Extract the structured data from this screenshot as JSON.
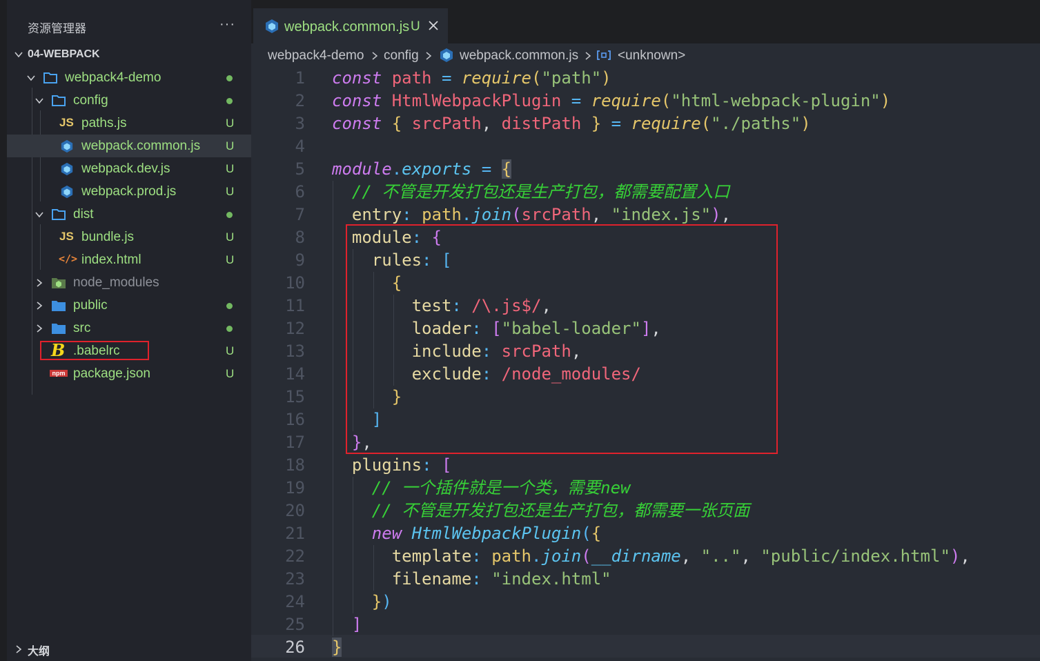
{
  "explorer": {
    "title": "资源管理器",
    "more": "···",
    "section": "04-WEBPACK",
    "outline": "大纲",
    "items": [
      {
        "label": "webpack4-demo",
        "status": "",
        "dot": true
      },
      {
        "label": "config",
        "status": "",
        "dot": true
      },
      {
        "label": "paths.js",
        "status": "U"
      },
      {
        "label": "webpack.common.js",
        "status": "U"
      },
      {
        "label": "webpack.dev.js",
        "status": "U"
      },
      {
        "label": "webpack.prod.js",
        "status": "U"
      },
      {
        "label": "dist",
        "status": "",
        "dot": true
      },
      {
        "label": "bundle.js",
        "status": "U"
      },
      {
        "label": "index.html",
        "status": "U"
      },
      {
        "label": "node_modules",
        "status": ""
      },
      {
        "label": "public",
        "status": "",
        "dot": true
      },
      {
        "label": "src",
        "status": "",
        "dot": true
      },
      {
        "label": ".babelrc",
        "status": "U"
      },
      {
        "label": "package.json",
        "status": "U"
      }
    ]
  },
  "tab": {
    "label": "webpack.common.js",
    "status": "U"
  },
  "breadcrumbs": [
    "webpack4-demo",
    "config",
    "webpack.common.js",
    "<unknown>"
  ],
  "code": {
    "line_numbers": [
      "1",
      "2",
      "3",
      "4",
      "5",
      "6",
      "7",
      "8",
      "9",
      "10",
      "11",
      "12",
      "13",
      "14",
      "15",
      "16",
      "17",
      "18",
      "19",
      "20",
      "21",
      "22",
      "23",
      "24",
      "25",
      "26"
    ],
    "active_line": "26",
    "l1": {
      "kw": "const",
      "var": "path",
      "op": "=",
      "fn": "require",
      "p1": "(",
      "str": "\"path\"",
      "p2": ")"
    },
    "l2": {
      "kw": "const",
      "var": "HtmlWebpackPlugin",
      "op": "=",
      "fn": "require",
      "p1": "(",
      "str": "\"html-webpack-plugin\"",
      "p2": ")"
    },
    "l3": {
      "kw": "const",
      "b1": "{",
      "v1": "srcPath",
      "c": ",",
      "v2": "distPath",
      "b2": "}",
      "op": "=",
      "fn": "require",
      "p1": "(",
      "str": "\"./paths\"",
      "p2": ")"
    },
    "l5": {
      "kw": "module",
      "dot": ".",
      "prop": "exports",
      "op": "=",
      "b": "{"
    },
    "l6": "// 不管是开发打包还是生产打包，都需要配置入口",
    "l7": {
      "key": "entry",
      "colon": ":",
      "obj": "path",
      "dot": ".",
      "fn": "join",
      "p1": "(",
      "arg": "srcPath",
      "c": ",",
      "str": "\"index.js\"",
      "p2": ")",
      "tail": ","
    },
    "l8": {
      "key": "module",
      "colon": ":",
      "b": "{"
    },
    "l9": {
      "key": "rules",
      "colon": ":",
      "b": "["
    },
    "l10": "{",
    "l11": {
      "key": "test",
      "colon": ":",
      "re": "/\\.js$/",
      "tail": ","
    },
    "l12": {
      "key": "loader",
      "colon": ":",
      "b1": "[",
      "str": "\"babel-loader\"",
      "b2": "]",
      "tail": ","
    },
    "l13": {
      "key": "include",
      "colon": ":",
      "val": "srcPath",
      "tail": ","
    },
    "l14": {
      "key": "exclude",
      "colon": ":",
      "re": "/node_modules/"
    },
    "l15": "}",
    "l16": "]",
    "l17": {
      "b": "}",
      "tail": ","
    },
    "l18": {
      "key": "plugins",
      "colon": ":",
      "b": "["
    },
    "l19": "// 一个插件就是一个类，需要new",
    "l20": "// 不管是开发打包还是生产打包，都需要一张页面",
    "l21": {
      "kw": "new",
      "cls": "HtmlWebpackPlugin",
      "p": "(",
      "b": "{"
    },
    "l22": {
      "key": "template",
      "colon": ":",
      "obj": "path",
      "dot": ".",
      "fn": "join",
      "p1": "(",
      "dn": "__dirname",
      "c1": ",",
      "s1": "\"..\"",
      "c2": ",",
      "s2": "\"public/index.html\"",
      "p2": ")",
      "tail": ","
    },
    "l23": {
      "key": "filename",
      "colon": ":",
      "str": "\"index.html\""
    },
    "l24": {
      "b": "}",
      "p": ")"
    },
    "l25": "]",
    "l26": "}"
  }
}
